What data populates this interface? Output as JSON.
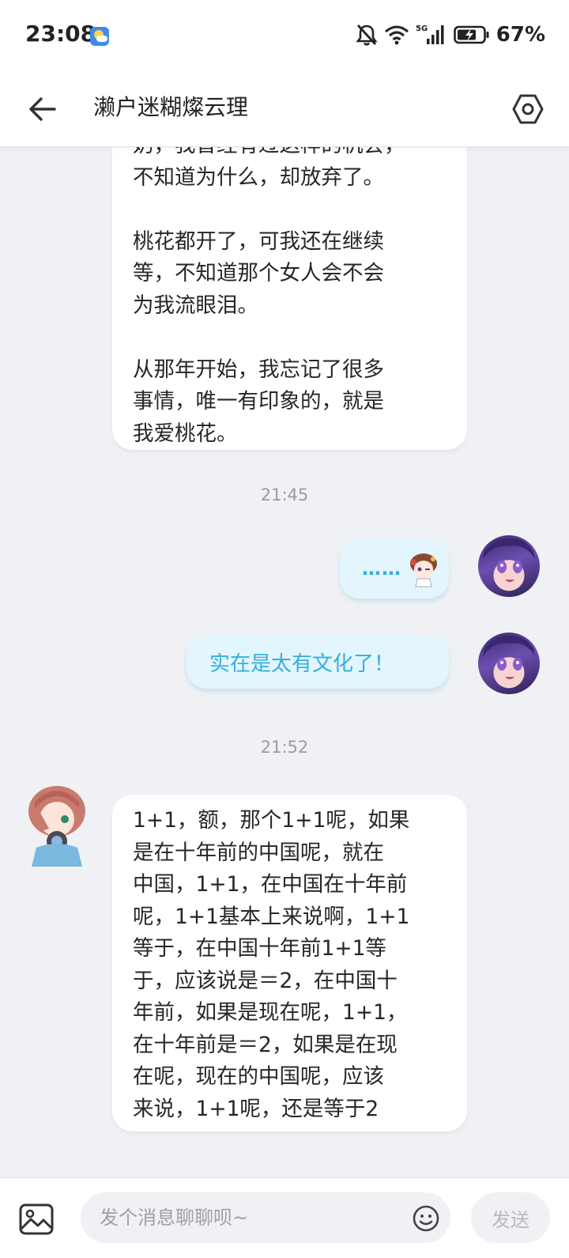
{
  "status_bar": {
    "time": "23:08",
    "network": "5G",
    "battery": "67%"
  },
  "header": {
    "title": "濑户迷糊燦云理"
  },
  "messages": {
    "top_message_text": "奶，我曾经有过这样的机会，\n不知道为什么，却放弃了。\n\n桃花都开了，可我还在继续\n等，不知道那个女人会不会\n为我流眼泪。\n\n从那年开始，我忘记了很多\n事情，唯一有印象的，就是\n我爱桃花。",
    "timestamp_1": "21:45",
    "sent_sticker_text": "……",
    "sent_text": "实在是太有文化了！",
    "timestamp_2": "21:52",
    "received_text": "1+1，额，那个1+1呢，如果\n是在十年前的中国呢，就在\n中国，1+1，在中国在十年前\n呢，1+1基本上来说啊，1+1\n等于，在中国十年前1+1等\n于，应该说是＝2，在中国十\n年前，如果是现在呢，1+1，\n在十年前是＝2，如果是在现\n在呢，现在的中国呢，应该\n来说，1+1呢，还是等于2"
  },
  "input_bar": {
    "placeholder": "发个消息聊聊呗~",
    "send_label": "发送"
  },
  "colors": {
    "accent_blue": "#33aee0",
    "sent_bubble_bg": "#e3f5fd",
    "page_bg": "#f0f1f4"
  },
  "icons": [
    "back-arrow-icon",
    "settings-icon",
    "image-icon",
    "emoji-icon",
    "mute-icon",
    "wifi-icon",
    "signal-icon",
    "battery-icon",
    "weather-icon"
  ]
}
